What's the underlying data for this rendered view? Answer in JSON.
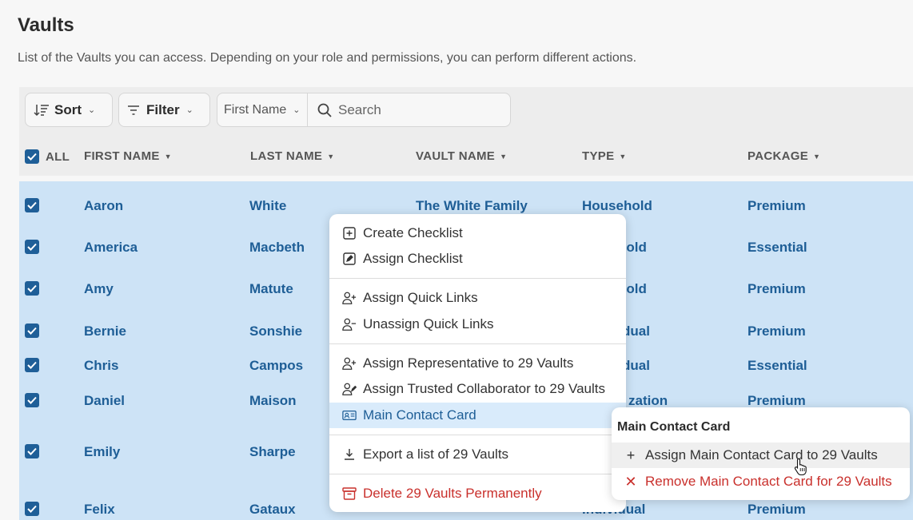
{
  "page": {
    "title": "Vaults",
    "subtitle": "List of the Vaults you can access. Depending on your role and permissions, you can perform different actions."
  },
  "toolbar": {
    "sort_label": "Sort",
    "filter_label": "Filter",
    "field_select_value": "First Name",
    "search_placeholder": "Search"
  },
  "table": {
    "select_all_label": "ALL",
    "columns": [
      "FIRST NAME",
      "LAST NAME",
      "VAULT NAME",
      "TYPE",
      "PACKAGE"
    ],
    "rows": [
      {
        "first": "Aaron",
        "last": "White",
        "vault": "The White Family",
        "type": "Household",
        "package": "Premium"
      },
      {
        "first": "America",
        "last": "Macbeth",
        "vault": "",
        "type": "hold",
        "package": "Essential"
      },
      {
        "first": "Amy",
        "last": "Matute",
        "vault": "",
        "type": "hold",
        "package": "Premium"
      },
      {
        "first": "Bernie",
        "last": "Sonshie",
        "vault": "",
        "type": "dual",
        "package": "Premium"
      },
      {
        "first": "Chris",
        "last": "Campos",
        "vault": "",
        "type": "dual",
        "package": "Essential"
      },
      {
        "first": "Daniel",
        "last": "Maison",
        "vault": "",
        "type": "zation",
        "package": "Premium"
      },
      {
        "first": "Emily",
        "last": "Sharpe",
        "vault": "",
        "type": "",
        "package": ""
      },
      {
        "first": "Felix",
        "last": "Gataux",
        "vault": "",
        "type": "Individual",
        "package": "Premium"
      }
    ]
  },
  "context_menu": {
    "items": [
      {
        "label": "Create Checklist",
        "icon": "plus-square-icon"
      },
      {
        "label": "Assign Checklist",
        "icon": "edit-square-icon"
      },
      {
        "label": "Assign Quick Links",
        "icon": "user-plus-icon"
      },
      {
        "label": "Unassign Quick Links",
        "icon": "user-minus-icon"
      },
      {
        "label": "Assign Representative to 29 Vaults",
        "icon": "user-plus-icon"
      },
      {
        "label": "Assign Trusted Collaborator to 29 Vaults",
        "icon": "user-edit-icon"
      },
      {
        "label": "Main Contact Card",
        "icon": "id-card-icon"
      },
      {
        "label": "Export a list of 29 Vaults",
        "icon": "download-icon"
      },
      {
        "label": "Delete 29 Vaults Permanently",
        "icon": "archive-icon"
      }
    ]
  },
  "submenu": {
    "title": "Main Contact Card",
    "items": [
      {
        "label": "Assign Main Contact Card to 29 Vaults",
        "icon": "plus-icon"
      },
      {
        "label": "Remove Main Contact Card for 29 Vaults",
        "icon": "x-icon"
      }
    ]
  },
  "colors": {
    "accent": "#1e5e96",
    "selected_row_bg": "#cde3f6",
    "danger": "#c9302c"
  }
}
